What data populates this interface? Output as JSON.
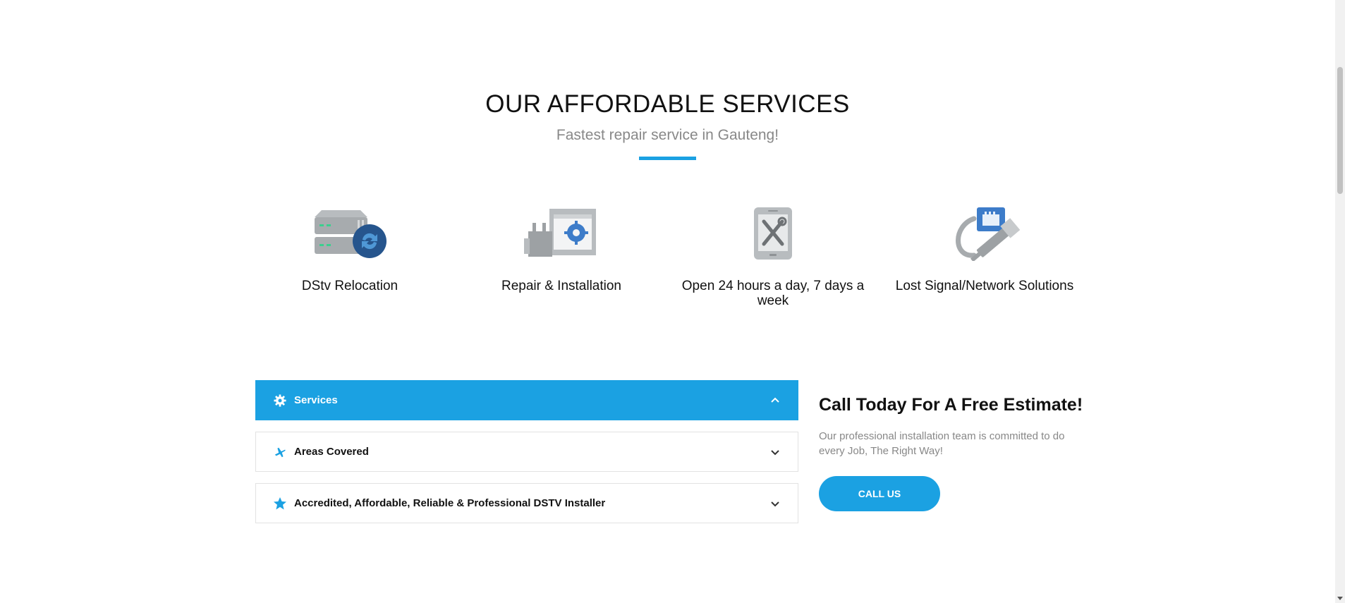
{
  "section": {
    "title": "OUR AFFORDABLE SERVICES",
    "subtitle": "Fastest repair service in Gauteng!",
    "accent_color": "#1ba1e2"
  },
  "features": [
    {
      "label": "DStv Relocation",
      "icon": "server-sync-icon"
    },
    {
      "label": "Repair & Installation",
      "icon": "plug-settings-icon"
    },
    {
      "label": "Open 24 hours a day, 7 days a week",
      "icon": "phone-tools-icon"
    },
    {
      "label": "Lost Signal/Network Solutions",
      "icon": "network-cable-icon"
    }
  ],
  "accordion": [
    {
      "label": "Services",
      "icon": "gear-icon",
      "expanded": true
    },
    {
      "label": "Areas Covered",
      "icon": "airplane-icon",
      "expanded": false
    },
    {
      "label": "Accredited, Affordable, Reliable & Professional DSTV Installer",
      "icon": "star-icon",
      "expanded": false
    }
  ],
  "cta": {
    "title": "Call Today For A Free Estimate!",
    "text": "Our professional installation team is committed to do every Job, The Right Way!",
    "button_label": "CALL US"
  }
}
